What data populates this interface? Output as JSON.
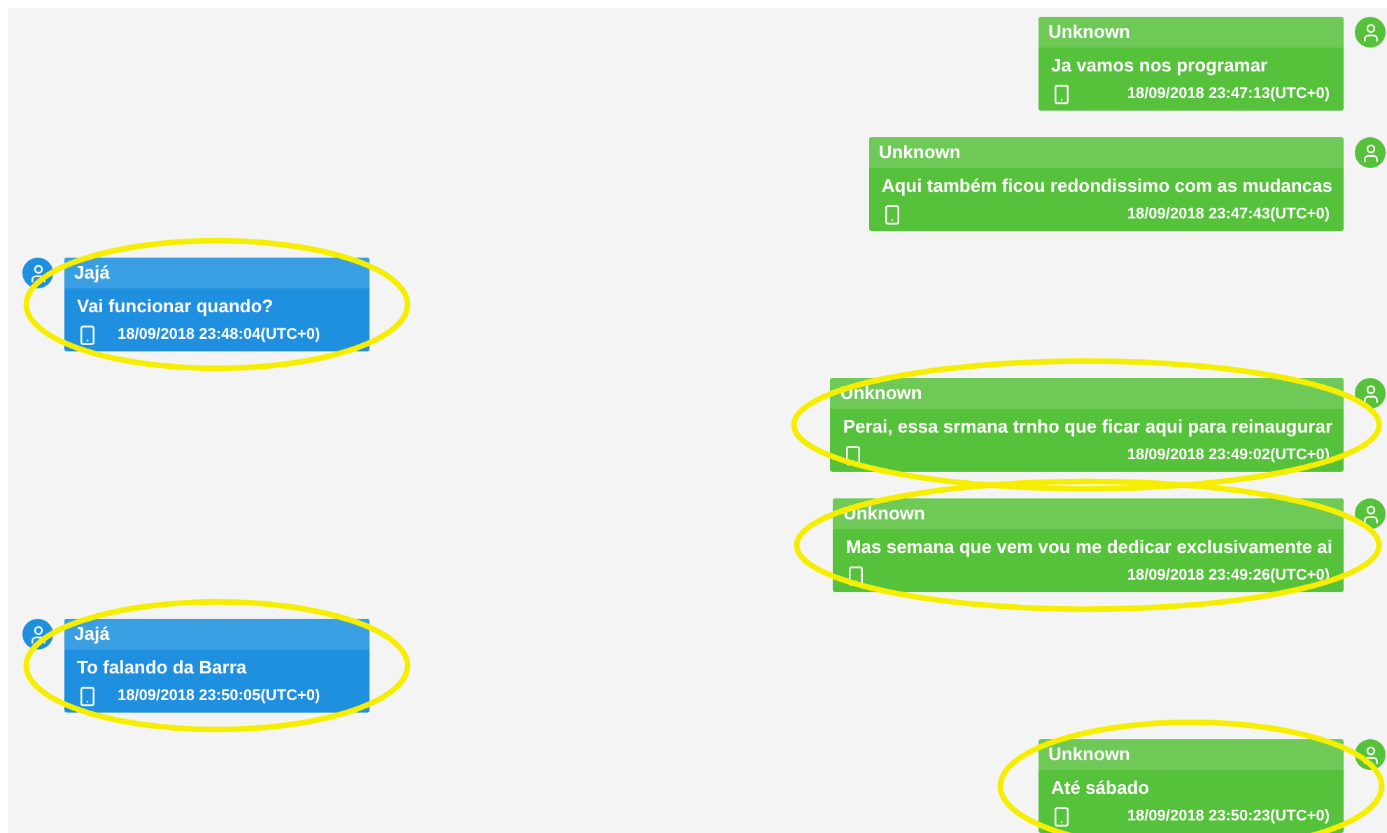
{
  "messages": [
    {
      "kind": "outgoing",
      "sender": "Unknown",
      "text": "Ja vamos nos programar",
      "time": "18/09/2018 23:47:13(UTC+0)",
      "highlighted": false
    },
    {
      "kind": "outgoing",
      "sender": "Unknown",
      "text": "Aqui também ficou redondissimo com as mudancas",
      "time": "18/09/2018 23:47:43(UTC+0)",
      "highlighted": false
    },
    {
      "kind": "incoming",
      "sender": "Jajá",
      "text": "Vai funcionar quando?",
      "time": "18/09/2018 23:48:04(UTC+0)",
      "highlighted": true
    },
    {
      "kind": "outgoing",
      "sender": "Unknown",
      "text": "Perai, essa srmana trnho que ficar aqui para reinaugurar",
      "time": "18/09/2018 23:49:02(UTC+0)",
      "highlighted": true
    },
    {
      "kind": "outgoing",
      "sender": "Unknown",
      "text": "Mas semana que vem vou me dedicar exclusivamente ai",
      "time": "18/09/2018 23:49:26(UTC+0)",
      "highlighted": true
    },
    {
      "kind": "incoming",
      "sender": "Jajá",
      "text": "To falando da Barra",
      "time": "18/09/2018 23:50:05(UTC+0)",
      "highlighted": true
    },
    {
      "kind": "outgoing",
      "sender": "Unknown",
      "text": "Até sábado",
      "time": "18/09/2018 23:50:23(UTC+0)",
      "highlighted": true
    }
  ]
}
